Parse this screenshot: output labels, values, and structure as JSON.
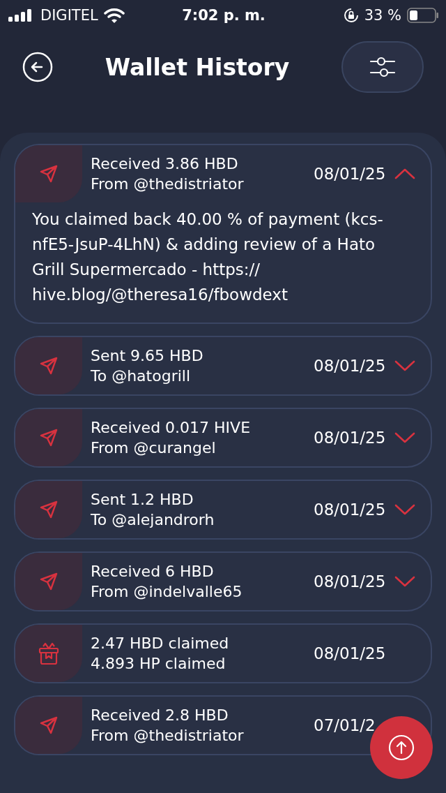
{
  "status_bar": {
    "carrier": "DIGITEL",
    "time": "7:02 p. m.",
    "battery": "33 %"
  },
  "header": {
    "title": "Wallet History"
  },
  "transactions": [
    {
      "kind": "transfer",
      "line1": "Received 3.86 HBD",
      "line2": "From @thedistriator",
      "date": "08/01/25",
      "expanded": true,
      "memo": "You claimed back 40.00 % of payment (kcs-nfE5-JsuP-4LhN) & adding review of a Hato Grill Supermercado - https:// hive.blog/@theresa16/fbowdext"
    },
    {
      "kind": "transfer",
      "line1": "Sent 9.65 HBD",
      "line2": "To @hatogrill",
      "date": "08/01/25",
      "expanded": false
    },
    {
      "kind": "transfer",
      "line1": "Received 0.017 HIVE",
      "line2": "From @curangel",
      "date": "08/01/25",
      "expanded": false
    },
    {
      "kind": "transfer",
      "line1": "Sent 1.2 HBD",
      "line2": "To @alejandrorh",
      "date": "08/01/25",
      "expanded": false
    },
    {
      "kind": "transfer",
      "line1": "Received 6 HBD",
      "line2": "From @indelvalle65",
      "date": "08/01/25",
      "expanded": false
    },
    {
      "kind": "claim",
      "line1": "2.47 HBD claimed",
      "line2": "4.893 HP claimed",
      "date": "08/01/25"
    },
    {
      "kind": "transfer",
      "line1": "Received 2.8 HBD",
      "line2": "From @thedistriator",
      "date": "07/01/2"
    }
  ]
}
